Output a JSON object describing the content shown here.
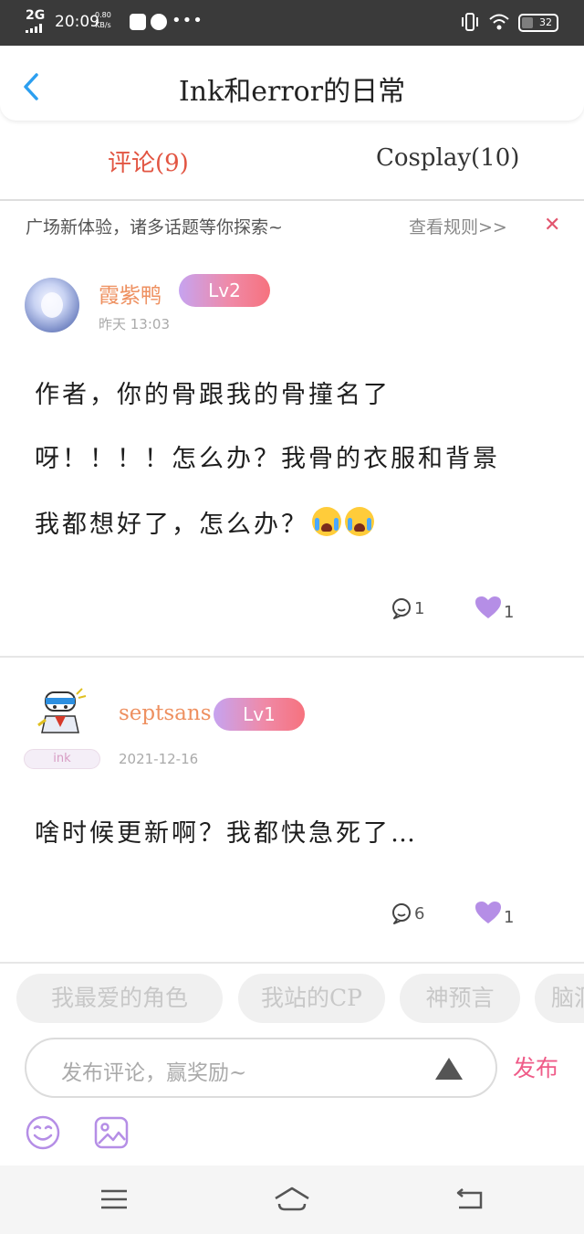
{
  "status_bar": {
    "network": "2G",
    "time": "20:09",
    "speed_value": "0.80",
    "speed_unit": "KB/s",
    "dots": "•••",
    "battery": "32",
    "battery_fraction": 0.32
  },
  "header": {
    "back_icon": "chevron-left-icon",
    "title": "Ink和error的日常"
  },
  "tabs": [
    {
      "label": "评论(9)",
      "active": true
    },
    {
      "label": "Cosplay(10)",
      "active": false
    }
  ],
  "notice": {
    "text": "广场新体验，诸多话题等你探索~",
    "link": "查看规则>>",
    "close": "✕"
  },
  "comments": [
    {
      "user": "霞紫鸭",
      "level": "Lv2",
      "time": "昨天 13:03",
      "badge": "",
      "lines": [
        "作者，你的骨跟我的骨撞名了",
        "呀！！！！怎么办？我骨的衣服和背景",
        "我都想好了，怎么办？"
      ],
      "emojis": [
        "loudly-crying-emoji",
        "loudly-crying-emoji"
      ],
      "comment_count": "1",
      "like_count": "1"
    },
    {
      "user": "septsans",
      "level": "Lv1",
      "time": "2021-12-16",
      "badge": "ink",
      "lines": [
        "啥时候更新啊？我都快急死了…"
      ],
      "comment_count": "6",
      "like_count": "1"
    }
  ],
  "topic_chips": [
    "我最爱的角色",
    "我站的CP",
    "神预言",
    "脑洞"
  ],
  "composer": {
    "placeholder": "发布评论，赢奖励~",
    "publish": "发布",
    "emoji_icon": "smiley-icon",
    "image_icon": "image-icon"
  },
  "navbar": {
    "icons": [
      "menu-icon",
      "home-icon",
      "back-icon"
    ]
  },
  "colors": {
    "accent_tab": "#e25542",
    "username": "#ee9060",
    "level_gradient_start": "#c6a3f0",
    "level_gradient_end": "#f6727e",
    "like_heart": "#b58ee6",
    "publish": "#ef5b88",
    "close": "#e2556e"
  }
}
